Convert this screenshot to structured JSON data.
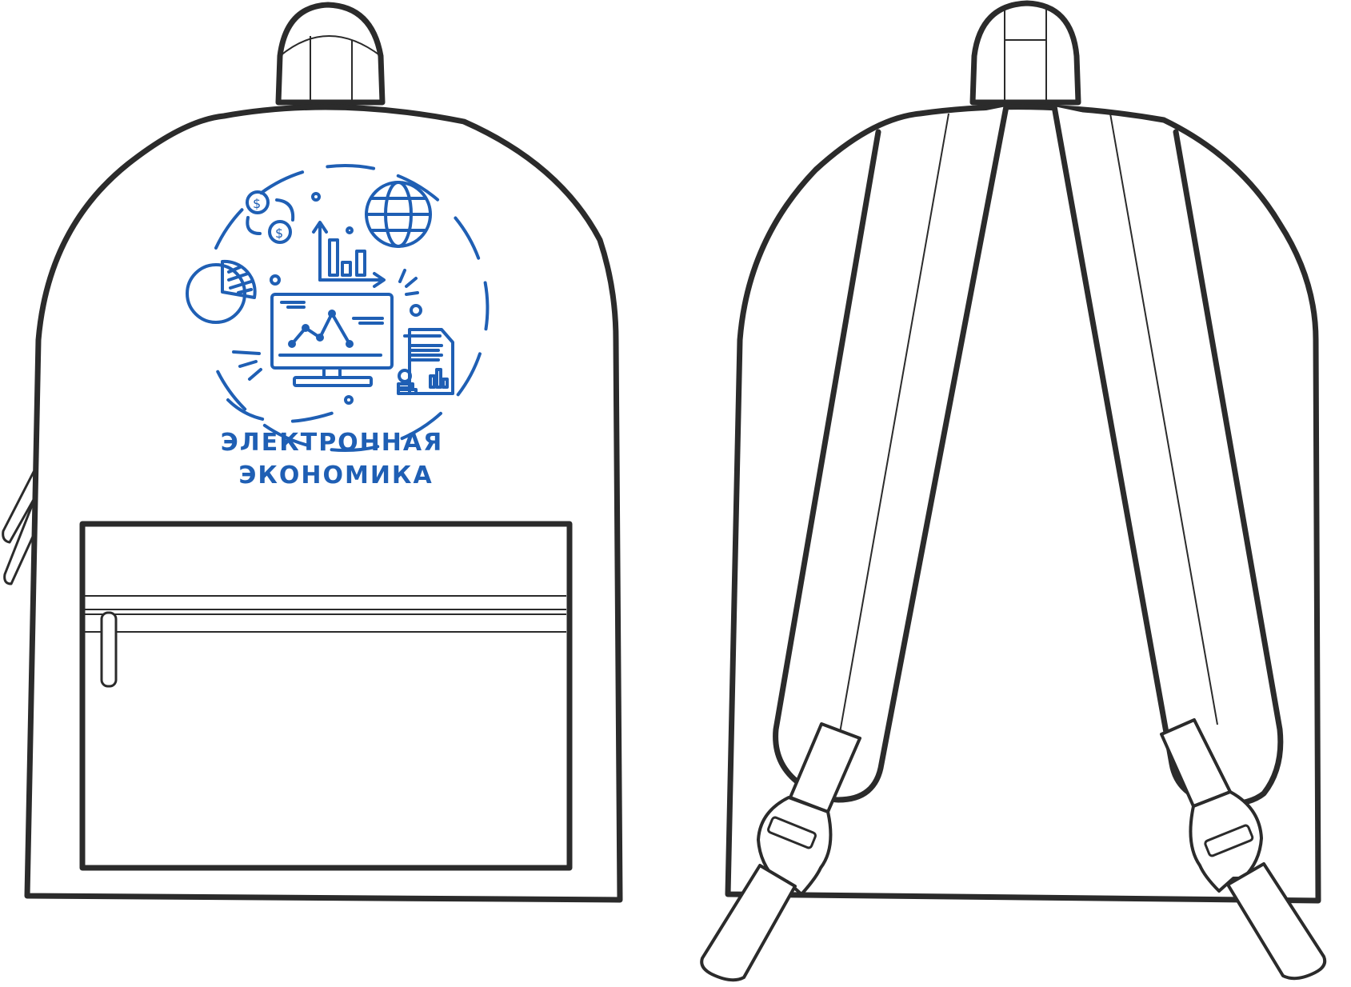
{
  "front_view": {
    "print": {
      "text_line_1": "ЭЛЕКТРОННАЯ",
      "text_line_2": "ЭКОНОМИКА",
      "print_color": "#1f5fb4"
    }
  },
  "outline_color": "#2b2b2b"
}
